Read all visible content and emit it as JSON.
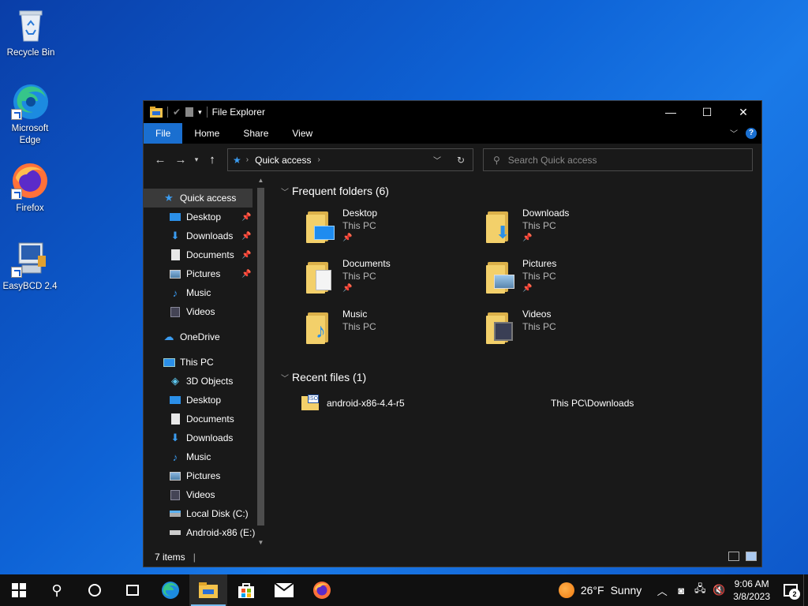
{
  "desktop": {
    "icons": [
      {
        "label": "Recycle Bin"
      },
      {
        "label": "Microsoft Edge"
      },
      {
        "label": "Firefox"
      },
      {
        "label": "EasyBCD 2.4"
      }
    ]
  },
  "window": {
    "title": "File Explorer",
    "controls": {
      "minimize": "—",
      "maximize": "☐",
      "close": "✕"
    },
    "ribbon_tabs": [
      "File",
      "Home",
      "Share",
      "View"
    ],
    "address": {
      "location": "Quick access"
    },
    "search": {
      "placeholder": "Search Quick access"
    },
    "sidebar": {
      "quick_access": "Quick access",
      "quick_items": [
        "Desktop",
        "Downloads",
        "Documents",
        "Pictures",
        "Music",
        "Videos"
      ],
      "onedrive": "OneDrive",
      "this_pc": "This PC",
      "pc_items": [
        "3D Objects",
        "Desktop",
        "Documents",
        "Downloads",
        "Music",
        "Pictures",
        "Videos",
        "Local Disk (C:)",
        "Android-x86 (E:)"
      ]
    },
    "frequent": {
      "header": "Frequent folders (6)",
      "folders": [
        {
          "name": "Desktop",
          "location": "This PC"
        },
        {
          "name": "Downloads",
          "location": "This PC"
        },
        {
          "name": "Documents",
          "location": "This PC"
        },
        {
          "name": "Pictures",
          "location": "This PC"
        },
        {
          "name": "Music",
          "location": "This PC"
        },
        {
          "name": "Videos",
          "location": "This PC"
        }
      ]
    },
    "recent": {
      "header": "Recent files (1)",
      "files": [
        {
          "name": "android-x86-4.4-r5",
          "location": "This PC\\Downloads"
        }
      ]
    },
    "status": {
      "items": "7 items"
    }
  },
  "taskbar": {
    "weather": {
      "temp": "26°F",
      "condition": "Sunny"
    },
    "clock": {
      "time": "9:06 AM",
      "date": "3/8/2023"
    },
    "notifications": "2"
  }
}
